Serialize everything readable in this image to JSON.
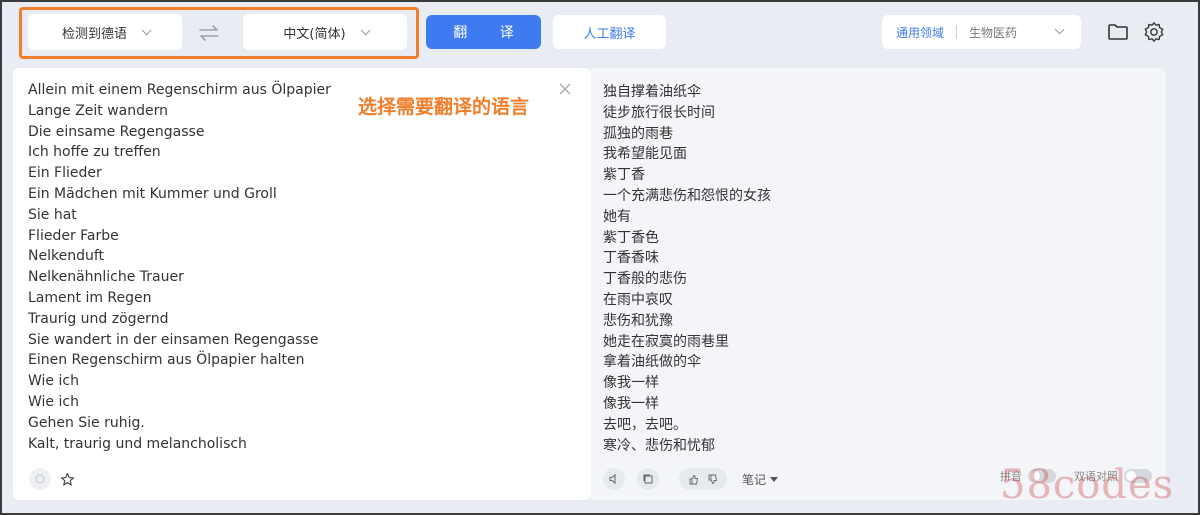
{
  "toolbar": {
    "source_language": "检测到德语",
    "target_language": "中文(简体)",
    "translate_button": "翻 译",
    "human_translate_button": "人工翻译",
    "domain_general": "通用领域",
    "domain_current": "生物医药"
  },
  "annotation": "选择需要翻译的语言",
  "source_text": [
    "Allein mit einem Regenschirm aus Ölpapier",
    "Lange Zeit wandern",
    "Die einsame Regengasse",
    "Ich hoffe zu treffen",
    "Ein Flieder",
    "Ein Mädchen mit Kummer und Groll",
    "Sie hat",
    "Flieder Farbe",
    "Nelkenduft",
    "Nelkenähnliche Trauer",
    "Lament im Regen",
    "Traurig und zögernd",
    "Sie wandert in der einsamen Regengasse",
    "Einen Regenschirm aus Ölpapier halten",
    "Wie ich",
    "Wie ich",
    "Gehen Sie ruhig.",
    "Kalt, traurig und melancholisch"
  ],
  "target_text": [
    "独自撑着油纸伞",
    "徒步旅行很长时间",
    "孤独的雨巷",
    "我希望能见面",
    "紫丁香",
    "一个充满悲伤和怨恨的女孩",
    "她有",
    "紫丁香色",
    "丁香香味",
    "丁香般的悲伤",
    "在雨中哀叹",
    "悲伤和犹豫",
    "她走在寂寞的雨巷里",
    "拿着油纸做的伞",
    "像我一样",
    "像我一样",
    "去吧，去吧。",
    "寒冷、悲伤和忧郁"
  ],
  "footer": {
    "notes_label": "笔记",
    "pinyin_label": "拼音",
    "bilingual_label": "双语对照"
  },
  "watermark": "58codes",
  "colors": {
    "accent": "#3e7bf0",
    "highlight": "#f07e2b",
    "background": "#e9edf3"
  }
}
